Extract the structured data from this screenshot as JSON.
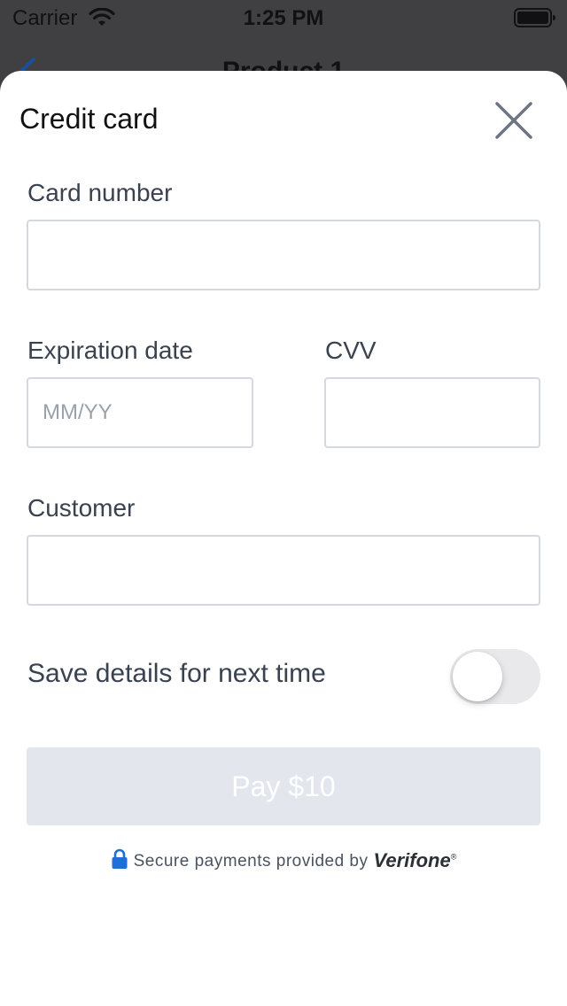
{
  "status_bar": {
    "carrier": "Carrier",
    "time": "1:25 PM"
  },
  "background_nav": {
    "title": "Product 1"
  },
  "sheet": {
    "title": "Credit card",
    "fields": {
      "card_number": {
        "label": "Card number",
        "value": "",
        "placeholder": ""
      },
      "expiration": {
        "label": "Expiration date",
        "value": "",
        "placeholder": "MM/YY"
      },
      "cvv": {
        "label": "CVV",
        "value": "",
        "placeholder": ""
      },
      "customer": {
        "label": "Customer",
        "value": "",
        "placeholder": ""
      }
    },
    "save_toggle": {
      "label": "Save details for next time",
      "on": false
    },
    "pay_button": {
      "label": "Pay $10"
    },
    "secure_text": "Secure payments provided by",
    "brand": "Verifone",
    "brand_mark": "®"
  },
  "colors": {
    "accent_blue": "#1f6fd8",
    "button_disabled_bg": "#e3e6ec",
    "label_text": "#3a4250",
    "input_border": "#d5d8de"
  },
  "icons": [
    "wifi-icon",
    "battery-icon",
    "back-chevron-icon",
    "close-icon",
    "lock-icon"
  ]
}
